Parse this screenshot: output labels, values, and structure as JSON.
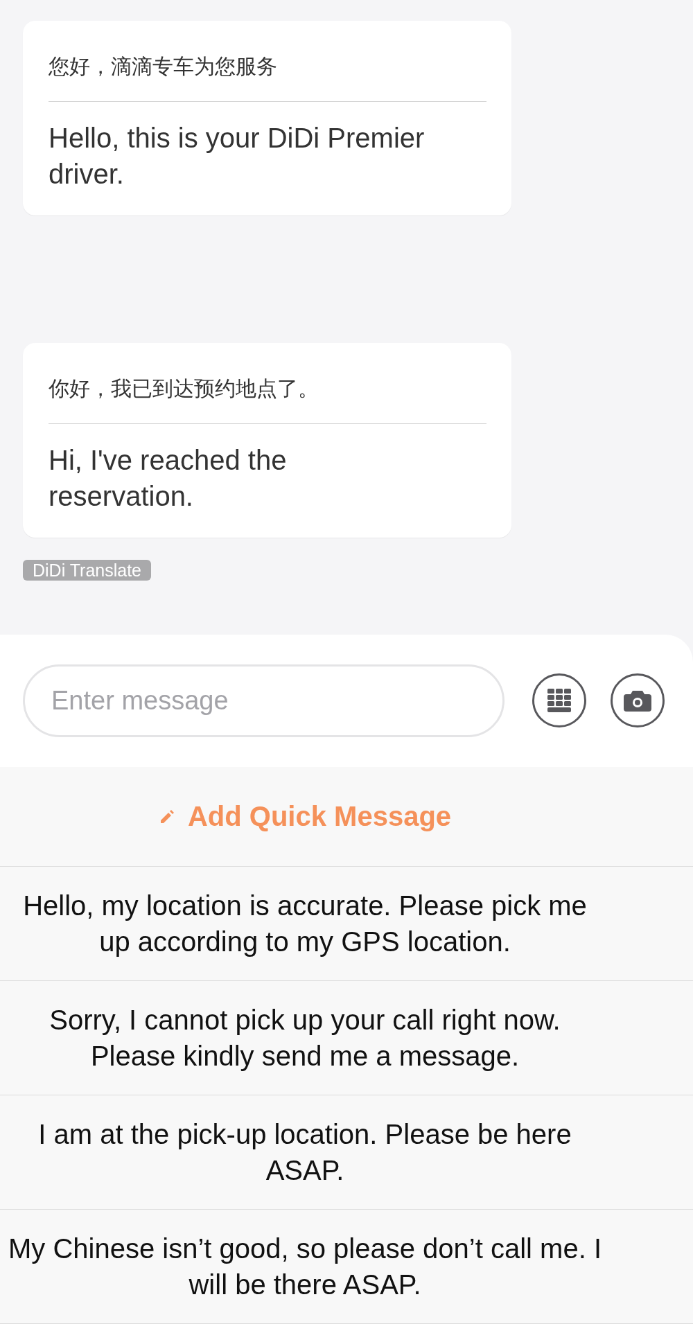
{
  "messages": [
    {
      "original": "您好，滴滴专车为您服务",
      "translation": "Hello, this is your DiDi Premier driver."
    },
    {
      "original": "你好，我已到达预约地点了。",
      "translation": "Hi, I've reached the reservation.",
      "translated_by": "DiDi Translate"
    }
  ],
  "composer": {
    "placeholder": "Enter message"
  },
  "quick_messages": {
    "add_label": "Add Quick Message",
    "items": [
      "Hello, my location is accurate. Please pick me up according to my GPS location.",
      "Sorry, I cannot pick up your call right now. Please kindly send me a message.",
      "I am at the pick-up location. Please be here ASAP.",
      "My Chinese isn’t good, so please don’t call me. I will be there ASAP."
    ]
  }
}
